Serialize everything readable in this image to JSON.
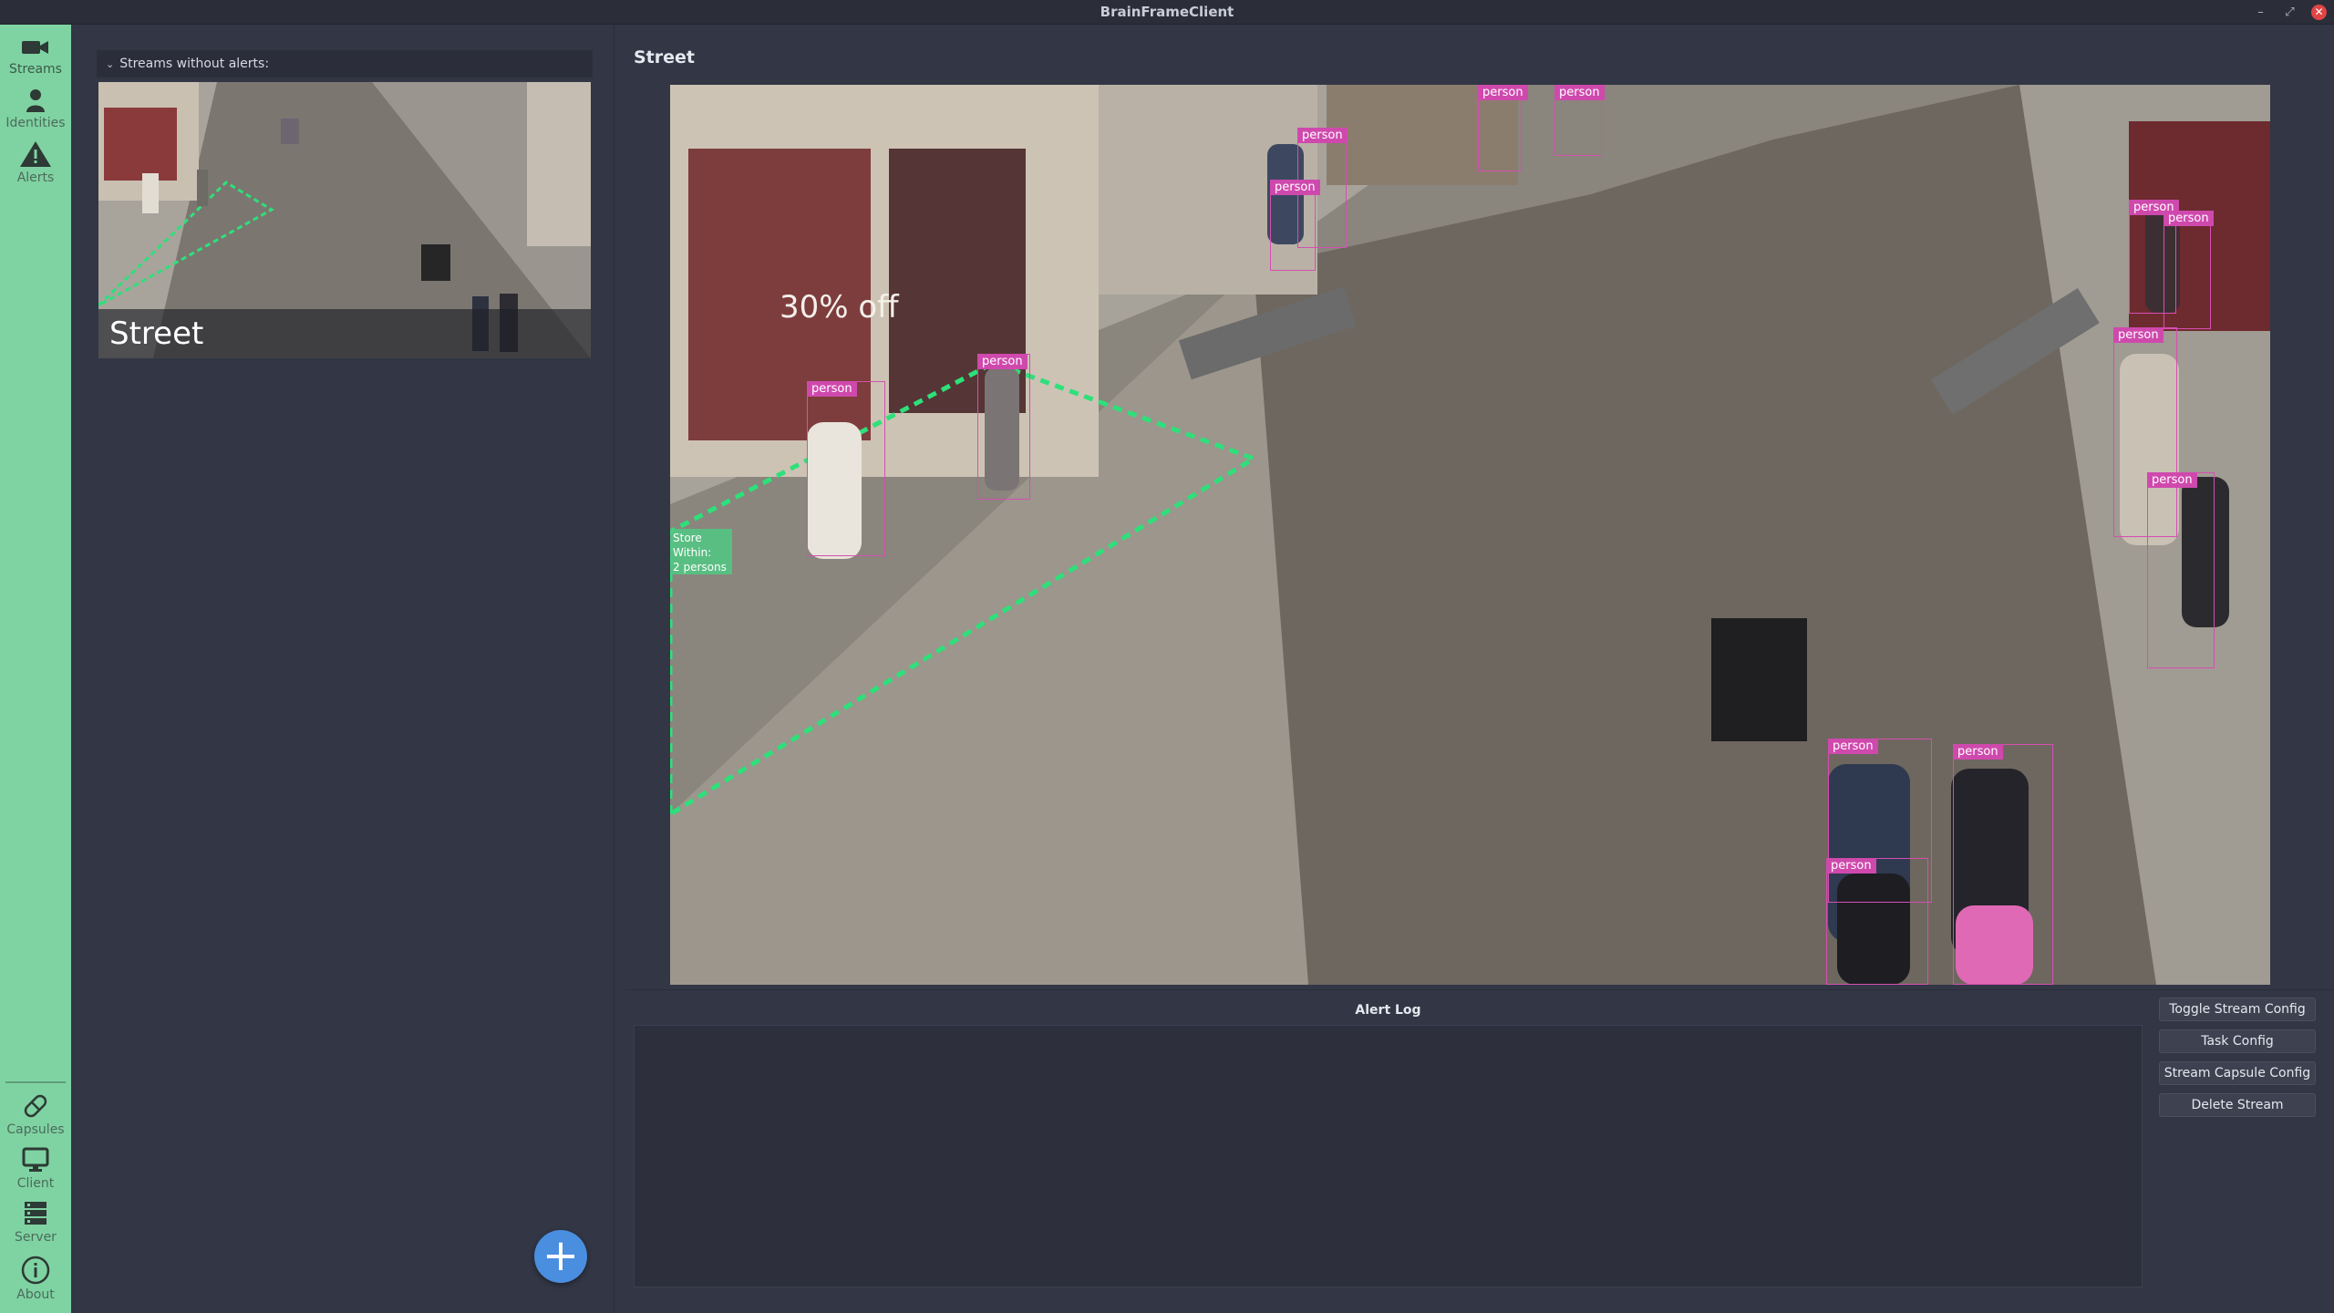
{
  "window": {
    "title": "BrainFrameClient"
  },
  "nav": {
    "top": [
      {
        "label": "Streams",
        "icon": "video-camera-icon"
      },
      {
        "label": "Identities",
        "icon": "person-icon"
      },
      {
        "label": "Alerts",
        "icon": "warning-icon"
      }
    ],
    "bottom": [
      {
        "label": "Capsules",
        "icon": "capsule-icon"
      },
      {
        "label": "Client",
        "icon": "monitor-icon"
      },
      {
        "label": "Server",
        "icon": "server-icon"
      },
      {
        "label": "About",
        "icon": "info-icon"
      }
    ]
  },
  "stream_list": {
    "group_header": "Streams without alerts:",
    "streams": [
      {
        "name": "Street"
      }
    ]
  },
  "main": {
    "stream_title": "Street",
    "zone": {
      "label_line1": "Store",
      "label_line2": "Within:",
      "label_line3": "2 persons"
    },
    "detection_label": "person",
    "alert_log_title": "Alert Log"
  },
  "actions": {
    "toggle_stream_config": "Toggle Stream Config",
    "task_config": "Task Config",
    "stream_capsule_config": "Stream Capsule Config",
    "delete_stream": "Delete Stream"
  },
  "colors": {
    "nav_background": "#7fd3a2",
    "detection_box": "#d64fb0",
    "zone_line": "#2ee07a",
    "add_button": "#4a8ee0"
  }
}
